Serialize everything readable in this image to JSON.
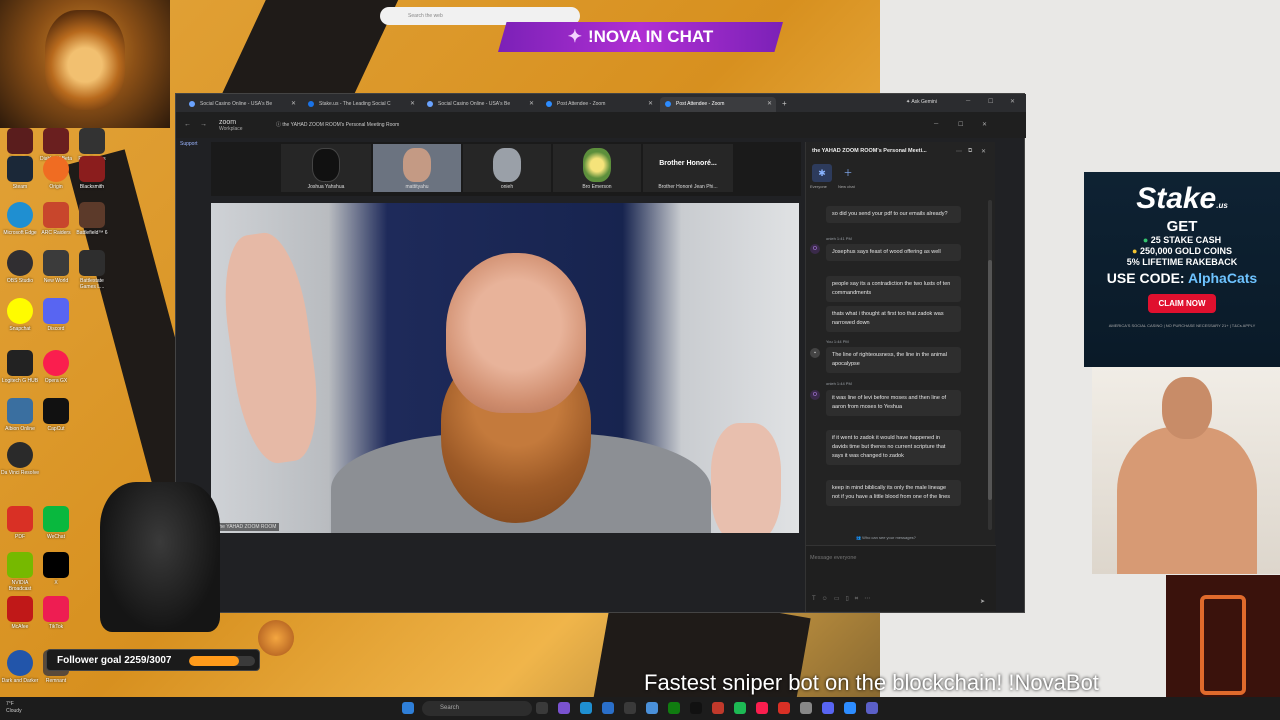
{
  "desktop": {
    "icons": [
      {
        "label": "Diablo IV"
      },
      {
        "label": "Diablo IV Beta"
      },
      {
        "label": "Epic Games Launcher"
      },
      {
        "label": "Steam"
      },
      {
        "label": "Origin"
      },
      {
        "label": "Blacksmith"
      },
      {
        "label": "Microsoft Edge"
      },
      {
        "label": "ARC Raiders"
      },
      {
        "label": "Battlefield™ 6"
      },
      {
        "label": "OBS Studio"
      },
      {
        "label": "New World"
      },
      {
        "label": "Battlestate Games L..."
      },
      {
        "label": "Snapchat"
      },
      {
        "label": "Discord"
      },
      {
        "label": "Logitech G HUB"
      },
      {
        "label": "Opera GX"
      },
      {
        "label": "Albion Online"
      },
      {
        "label": "CapCut"
      },
      {
        "label": "Da Vinci Resolve"
      },
      {
        "label": "PDF"
      },
      {
        "label": "WeChat"
      },
      {
        "label": "NVIDIA Broadcast"
      },
      {
        "label": "X"
      },
      {
        "label": "McAfee"
      },
      {
        "label": "TikTok"
      },
      {
        "label": "Dark and Darker"
      },
      {
        "label": "Remnant"
      }
    ]
  },
  "search_overlay": {
    "placeholder": "Search the web"
  },
  "nova_banner": {
    "text": "!NOVA  IN CHAT"
  },
  "browser": {
    "tabs": [
      {
        "label": "Social Casino Online - USA's Be"
      },
      {
        "label": "Stake.us - The Leading Social C"
      },
      {
        "label": "Social Casino Online - USA's Be"
      },
      {
        "label": "Post Attendee - Zoom"
      },
      {
        "label": "Post Attendee - Zoom",
        "active": true
      }
    ],
    "ask_gemini": "Ask Gemini",
    "support_label": "Support"
  },
  "zoom": {
    "brand": "zoom",
    "brand_sub": "Workplace",
    "meeting_title": "the YAHAD ZOOM ROOM's Personal Meeting Room",
    "participants": [
      {
        "name": "Joshua Yahshua"
      },
      {
        "name": "mattityahu"
      },
      {
        "name": "onieh"
      },
      {
        "name": "Bro Emerson"
      },
      {
        "name": "Brother Honoré Jean Phi...",
        "display": "Brother  Honoré..."
      }
    ],
    "speaker_label": "the YAHAD ZOOM ROOM"
  },
  "chat": {
    "title": "the YAHAD ZOOM ROOM's Personal Meeti...",
    "tabs": [
      {
        "label": "Everyone"
      },
      {
        "label": "New chat"
      }
    ],
    "messages": [
      {
        "text": "so did you send your pdf to our emails already?"
      },
      {
        "meta": "onieh  1:41 PM"
      },
      {
        "text": "Josephus says feast of wood offering as well"
      },
      {
        "text": "people say its a contradiction the two lusts of ten commandments"
      },
      {
        "text": "thats what i thought at first too that zadok was narrowed down"
      },
      {
        "meta": "You  1:44 PM"
      },
      {
        "text": "The line of righteousness, the line in the animal apocalypse"
      },
      {
        "meta": "onieh  1:44 PM"
      },
      {
        "text": "it was line of levi before moses and then line of aaron from moses to Yeshua"
      },
      {
        "text": "if it went to zadok it would have happened in davids time but theres no current scripture that says it was changed to zadok"
      },
      {
        "text": "keep in mind biblically its only the male lineage not if you have a little blood from one of the lines"
      }
    ],
    "who_can_see": "Who can see your messages?",
    "compose_placeholder": "Message everyone"
  },
  "stake_ad": {
    "logo": "Stake",
    "logo_sub": ".us",
    "get": "GET",
    "line1": "25 STAKE CASH",
    "line2": "250,000 GOLD COINS",
    "line3": "5% LIFETIME RAKEBACK",
    "code_prefix": "USE CODE: ",
    "code": "AlphaCats",
    "cta": "CLAIM NOW",
    "fine_print": "AMERICA'S SOCIAL CASINO | NO PURCHASE NECESSARY    21+ | T&Cs APPLY"
  },
  "follower_goal": {
    "text": "Follower goal 2259/3007",
    "current": 2259,
    "target": 3007,
    "bar_color": "#ff9a1a"
  },
  "ticker": {
    "text": "Fastest sniper bot on the blockchain! !NovaBot"
  },
  "taskbar": {
    "search_placeholder": "Search",
    "weather_temp": "7°F",
    "weather_desc": "Cloudy"
  }
}
